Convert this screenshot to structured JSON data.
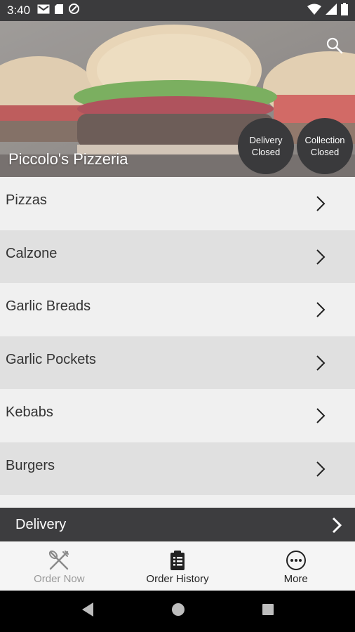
{
  "status_bar": {
    "time": "3:40",
    "left_icons": [
      "gmail-icon",
      "sd-card-icon",
      "data-saver-icon"
    ],
    "right_icons": [
      "wifi-icon",
      "signal-icon",
      "battery-icon"
    ]
  },
  "header": {
    "restaurant_name": "Piccolo's Pizzeria",
    "search_icon": "search-icon",
    "badges": [
      {
        "line1": "Delivery",
        "line2": "Closed"
      },
      {
        "line1": "Collection",
        "line2": "Closed"
      }
    ]
  },
  "menu": {
    "items": [
      {
        "label": "Pizzas"
      },
      {
        "label": "Calzone"
      },
      {
        "label": "Garlic Breads"
      },
      {
        "label": "Garlic Pockets"
      },
      {
        "label": "Kebabs"
      },
      {
        "label": "Burgers"
      }
    ],
    "chevron_icon": "chevron-right-icon"
  },
  "delivery_bar": {
    "label": "Delivery"
  },
  "bottom_nav": {
    "items": [
      {
        "label": "Order Now",
        "icon": "fork-knife-icon",
        "state": "dim"
      },
      {
        "label": "Order History",
        "icon": "clipboard-icon",
        "state": "normal"
      },
      {
        "label": "More",
        "icon": "more-dots-icon",
        "state": "normal"
      }
    ]
  },
  "system_nav": {
    "buttons": [
      "back-icon",
      "home-icon",
      "recents-icon"
    ]
  },
  "colors": {
    "dark": "#3a3a3c",
    "row_light": "#f0f0f0",
    "row_dark": "#e0e0e0",
    "nav_dim": "#9a9a9a"
  }
}
